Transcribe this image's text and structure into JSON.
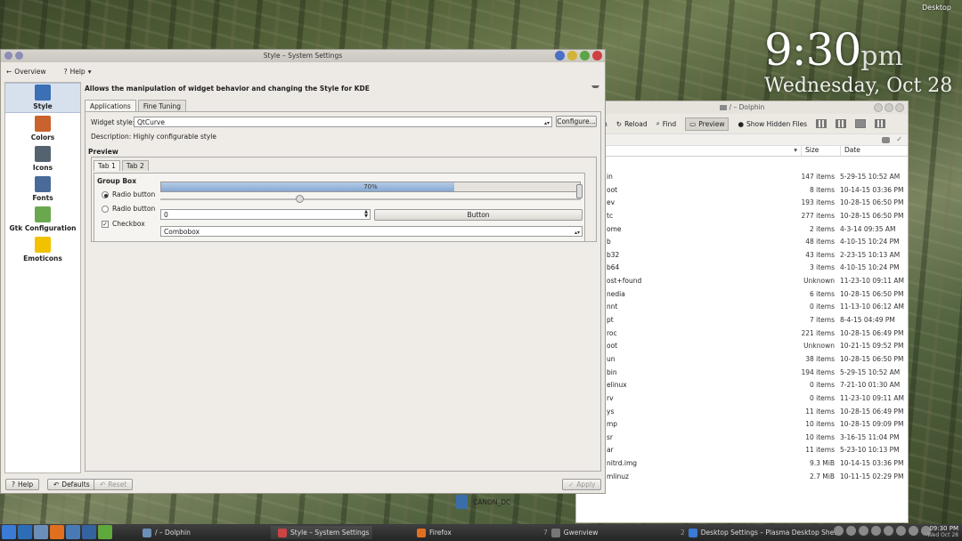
{
  "desktop": {
    "label": "Desktop",
    "clock_time": "9:30",
    "clock_ampm": "pm",
    "clock_date": "Wednesday, Oct 28"
  },
  "settings": {
    "title": "Style – System Settings",
    "menu": {
      "overview": "Overview",
      "help": "Help"
    },
    "sidebar": [
      {
        "label": "Style",
        "icon": "brush-icon",
        "color": "#3b6fb6"
      },
      {
        "label": "Colors",
        "icon": "palette-icon",
        "color": "#c9622c"
      },
      {
        "label": "Icons",
        "icon": "icons-icon",
        "color": "#556270"
      },
      {
        "label": "Fonts",
        "icon": "font-icon",
        "color": "#4a6a9a"
      },
      {
        "label": "Gtk Configuration",
        "icon": "gtk-icon",
        "color": "#6aa84f"
      },
      {
        "label": "Emoticons",
        "icon": "smiley-icon",
        "color": "#f2c200"
      }
    ],
    "description": "Allows the manipulation of widget behavior and changing the Style for KDE",
    "tabs": [
      "Applications",
      "Fine Tuning"
    ],
    "widget_style_label": "Widget style:",
    "widget_style_value": "QtCurve",
    "configure_label": "Configure...",
    "style_description": "Description: Highly configurable style",
    "preview_label": "Preview",
    "preview_tabs": [
      "Tab 1",
      "Tab 2"
    ],
    "group_box": "Group Box",
    "radio1": "Radio button",
    "radio2": "Radio button",
    "checkbox": "Checkbox",
    "progress_text": "70%",
    "progress_value": 0.7,
    "slider_value": 0.33,
    "spin_value": "0",
    "button_label": "Button",
    "combobox_value": "Combobox",
    "bottom": {
      "help": "Help",
      "defaults": "Defaults",
      "reset": "Reset",
      "apply": "Apply"
    }
  },
  "dolphin": {
    "title": "/ – Dolphin",
    "toolbar": {
      "h": "h",
      "reload": "Reload",
      "find": "Find",
      "preview": "Preview",
      "hidden": "Show Hidden Files"
    },
    "columns": {
      "size": "Size",
      "date": "Date"
    },
    "rows": [
      {
        "name": "in",
        "size": "147 items",
        "date": "5-29-15 10:52 AM"
      },
      {
        "name": "oot",
        "size": "8 items",
        "date": "10-14-15 03:36 PM"
      },
      {
        "name": "ev",
        "size": "193 items",
        "date": "10-28-15 06:50 PM"
      },
      {
        "name": "tc",
        "size": "277 items",
        "date": "10-28-15 06:50 PM"
      },
      {
        "name": "ome",
        "size": "2 items",
        "date": "4-3-14 09:35 AM"
      },
      {
        "name": "b",
        "size": "48 items",
        "date": "4-10-15 10:24 PM"
      },
      {
        "name": "b32",
        "size": "43 items",
        "date": "2-23-15 10:13 AM"
      },
      {
        "name": "b64",
        "size": "3 items",
        "date": "4-10-15 10:24 PM"
      },
      {
        "name": "ost+found",
        "size": "Unknown",
        "date": "11-23-10 09:11 AM"
      },
      {
        "name": "nedia",
        "size": "6 items",
        "date": "10-28-15 06:50 PM"
      },
      {
        "name": "nnt",
        "size": "0 items",
        "date": "11-13-10 06:12 AM"
      },
      {
        "name": "pt",
        "size": "7 items",
        "date": "8-4-15 04:49 PM"
      },
      {
        "name": "roc",
        "size": "221 items",
        "date": "10-28-15 06:49 PM"
      },
      {
        "name": "oot",
        "size": "Unknown",
        "date": "10-21-15 09:52 PM"
      },
      {
        "name": "un",
        "size": "38 items",
        "date": "10-28-15 06:50 PM"
      },
      {
        "name": "bin",
        "size": "194 items",
        "date": "5-29-15 10:52 AM"
      },
      {
        "name": "elinux",
        "size": "0 items",
        "date": "7-21-10 01:30 AM"
      },
      {
        "name": "rv",
        "size": "0 items",
        "date": "11-23-10 09:11 AM"
      },
      {
        "name": "ys",
        "size": "11 items",
        "date": "10-28-15 06:49 PM"
      },
      {
        "name": "mp",
        "size": "10 items",
        "date": "10-28-15 09:09 PM"
      },
      {
        "name": "sr",
        "size": "10 items",
        "date": "3-16-15 11:04 PM"
      },
      {
        "name": "ar",
        "size": "11 items",
        "date": "5-23-10 10:13 PM"
      },
      {
        "name": "nitrd.img",
        "size": "9.3 MiB",
        "date": "10-14-15 03:36 PM"
      },
      {
        "name": "mlinuz",
        "size": "2.7 MiB",
        "date": "10-11-15 02:29 PM"
      }
    ],
    "device": "CANON_DC"
  },
  "taskbar": {
    "tasks": [
      {
        "label": "/ – Dolphin",
        "num": ""
      },
      {
        "label": "Style – System Settings",
        "num": ""
      },
      {
        "label": "Firefox",
        "num": ""
      },
      {
        "label": "Gwenview",
        "num": "7"
      },
      {
        "label": "Desktop Settings – Plasma Desktop Shell",
        "num": "2"
      }
    ],
    "time": "09:30 PM",
    "date": "Wed Oct 28"
  }
}
